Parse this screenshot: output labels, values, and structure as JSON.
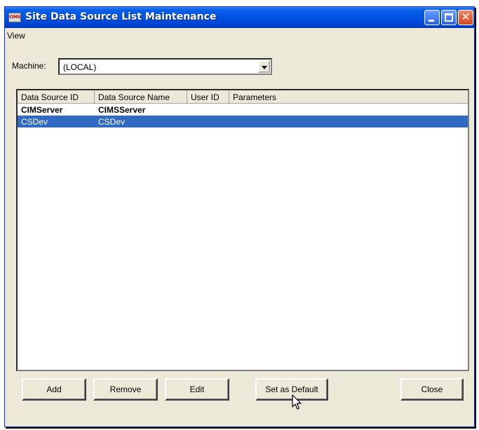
{
  "window": {
    "title": "Site Data Source List Maintenance",
    "icon_text": "CIMS",
    "close_glyph": "✕"
  },
  "menu": {
    "items": [
      {
        "label": "View"
      }
    ]
  },
  "machine": {
    "label": "Machine:",
    "value": "(LOCAL)"
  },
  "list": {
    "columns": [
      "Data Source ID",
      "Data Source Name",
      "User ID",
      "Parameters"
    ],
    "rows": [
      {
        "id": "CIMServer",
        "name": "CIMSServer",
        "user": "",
        "params": "",
        "bold": true,
        "selected": false
      },
      {
        "id": "CSDev",
        "name": "CSDev",
        "user": "",
        "params": "",
        "bold": false,
        "selected": true
      }
    ]
  },
  "buttons": {
    "add": "Add",
    "remove": "Remove",
    "edit": "Edit",
    "set_default": "Set as Default",
    "close": "Close"
  },
  "colors": {
    "selection": "#316ac5",
    "titlebar": "#0054e3",
    "face": "#ece9d8"
  }
}
